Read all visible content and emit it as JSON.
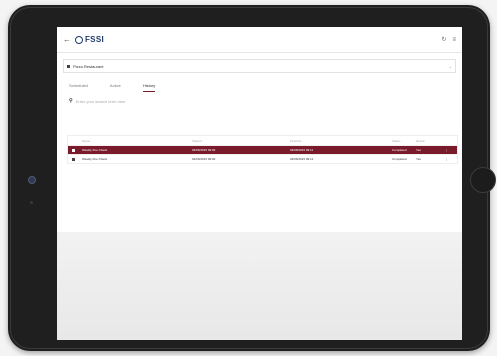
{
  "appbar": {
    "back_icon": "arrow-left-icon",
    "logo_text": "FSSI",
    "refresh_icon": "refresh-icon",
    "menu_icon": "menu-icon"
  },
  "location_select": {
    "value": "Pizza Restaurant"
  },
  "tabs": [
    {
      "label": "Scheduled",
      "active": false
    },
    {
      "label": "Active",
      "active": false
    },
    {
      "label": "History",
      "active": true
    }
  ],
  "search": {
    "placeholder": "Enter your search term here"
  },
  "table": {
    "headers": [
      "",
      "Name",
      "Started",
      "Finished",
      "Status",
      "Result",
      ""
    ],
    "rows": [
      {
        "name": "Weekly Fire Check",
        "started": "04/06/2015 09:00",
        "finished": "04/06/2015 09:11",
        "status": "Completed",
        "result": "Yes",
        "selected": true
      },
      {
        "name": "Weekly Fire Check",
        "started": "04/06/2015 09:00",
        "finished": "04/06/2015 09:12",
        "status": "Completed",
        "result": "Yes",
        "selected": false
      }
    ]
  },
  "colors": {
    "accent": "#7a1b2c",
    "brand": "#1b3a6b"
  }
}
